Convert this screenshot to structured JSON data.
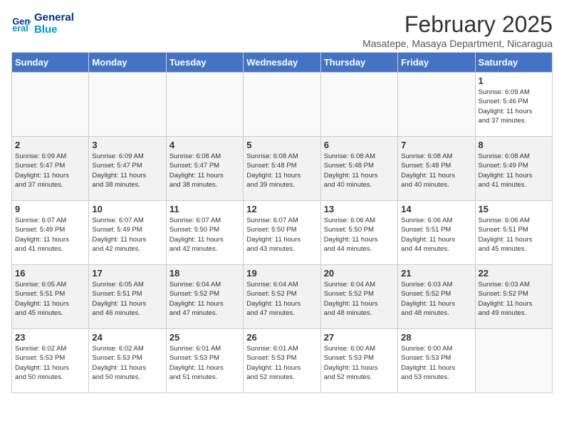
{
  "logo": {
    "line1": "General",
    "line2": "Blue"
  },
  "title": {
    "month_year": "February 2025",
    "location": "Masatepe, Masaya Department, Nicaragua"
  },
  "days_of_week": [
    "Sunday",
    "Monday",
    "Tuesday",
    "Wednesday",
    "Thursday",
    "Friday",
    "Saturday"
  ],
  "weeks": [
    [
      {
        "day": "",
        "info": ""
      },
      {
        "day": "",
        "info": ""
      },
      {
        "day": "",
        "info": ""
      },
      {
        "day": "",
        "info": ""
      },
      {
        "day": "",
        "info": ""
      },
      {
        "day": "",
        "info": ""
      },
      {
        "day": "1",
        "info": "Sunrise: 6:09 AM\nSunset: 5:46 PM\nDaylight: 11 hours\nand 37 minutes."
      }
    ],
    [
      {
        "day": "2",
        "info": "Sunrise: 6:09 AM\nSunset: 5:47 PM\nDaylight: 11 hours\nand 37 minutes."
      },
      {
        "day": "3",
        "info": "Sunrise: 6:09 AM\nSunset: 5:47 PM\nDaylight: 11 hours\nand 38 minutes."
      },
      {
        "day": "4",
        "info": "Sunrise: 6:08 AM\nSunset: 5:47 PM\nDaylight: 11 hours\nand 38 minutes."
      },
      {
        "day": "5",
        "info": "Sunrise: 6:08 AM\nSunset: 5:48 PM\nDaylight: 11 hours\nand 39 minutes."
      },
      {
        "day": "6",
        "info": "Sunrise: 6:08 AM\nSunset: 5:48 PM\nDaylight: 11 hours\nand 40 minutes."
      },
      {
        "day": "7",
        "info": "Sunrise: 6:08 AM\nSunset: 5:48 PM\nDaylight: 11 hours\nand 40 minutes."
      },
      {
        "day": "8",
        "info": "Sunrise: 6:08 AM\nSunset: 5:49 PM\nDaylight: 11 hours\nand 41 minutes."
      }
    ],
    [
      {
        "day": "9",
        "info": "Sunrise: 6:07 AM\nSunset: 5:49 PM\nDaylight: 11 hours\nand 41 minutes."
      },
      {
        "day": "10",
        "info": "Sunrise: 6:07 AM\nSunset: 5:49 PM\nDaylight: 11 hours\nand 42 minutes."
      },
      {
        "day": "11",
        "info": "Sunrise: 6:07 AM\nSunset: 5:50 PM\nDaylight: 11 hours\nand 42 minutes."
      },
      {
        "day": "12",
        "info": "Sunrise: 6:07 AM\nSunset: 5:50 PM\nDaylight: 11 hours\nand 43 minutes."
      },
      {
        "day": "13",
        "info": "Sunrise: 6:06 AM\nSunset: 5:50 PM\nDaylight: 11 hours\nand 44 minutes."
      },
      {
        "day": "14",
        "info": "Sunrise: 6:06 AM\nSunset: 5:51 PM\nDaylight: 11 hours\nand 44 minutes."
      },
      {
        "day": "15",
        "info": "Sunrise: 6:06 AM\nSunset: 5:51 PM\nDaylight: 11 hours\nand 45 minutes."
      }
    ],
    [
      {
        "day": "16",
        "info": "Sunrise: 6:05 AM\nSunset: 5:51 PM\nDaylight: 11 hours\nand 45 minutes."
      },
      {
        "day": "17",
        "info": "Sunrise: 6:05 AM\nSunset: 5:51 PM\nDaylight: 11 hours\nand 46 minutes."
      },
      {
        "day": "18",
        "info": "Sunrise: 6:04 AM\nSunset: 5:52 PM\nDaylight: 11 hours\nand 47 minutes."
      },
      {
        "day": "19",
        "info": "Sunrise: 6:04 AM\nSunset: 5:52 PM\nDaylight: 11 hours\nand 47 minutes."
      },
      {
        "day": "20",
        "info": "Sunrise: 6:04 AM\nSunset: 5:52 PM\nDaylight: 11 hours\nand 48 minutes."
      },
      {
        "day": "21",
        "info": "Sunrise: 6:03 AM\nSunset: 5:52 PM\nDaylight: 11 hours\nand 48 minutes."
      },
      {
        "day": "22",
        "info": "Sunrise: 6:03 AM\nSunset: 5:52 PM\nDaylight: 11 hours\nand 49 minutes."
      }
    ],
    [
      {
        "day": "23",
        "info": "Sunrise: 6:02 AM\nSunset: 5:53 PM\nDaylight: 11 hours\nand 50 minutes."
      },
      {
        "day": "24",
        "info": "Sunrise: 6:02 AM\nSunset: 5:53 PM\nDaylight: 11 hours\nand 50 minutes."
      },
      {
        "day": "25",
        "info": "Sunrise: 6:01 AM\nSunset: 5:53 PM\nDaylight: 11 hours\nand 51 minutes."
      },
      {
        "day": "26",
        "info": "Sunrise: 6:01 AM\nSunset: 5:53 PM\nDaylight: 11 hours\nand 52 minutes."
      },
      {
        "day": "27",
        "info": "Sunrise: 6:00 AM\nSunset: 5:53 PM\nDaylight: 11 hours\nand 52 minutes."
      },
      {
        "day": "28",
        "info": "Sunrise: 6:00 AM\nSunset: 5:53 PM\nDaylight: 11 hours\nand 53 minutes."
      },
      {
        "day": "",
        "info": ""
      }
    ]
  ]
}
